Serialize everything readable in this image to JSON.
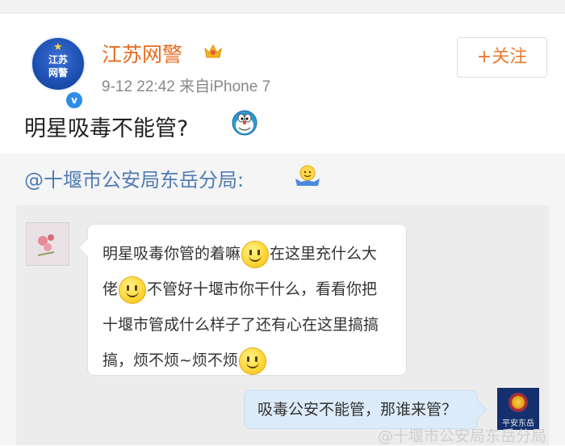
{
  "post": {
    "author": "江苏网警",
    "avatar_text_line1": "江苏",
    "avatar_text_line2": "网警",
    "meta": "9-12 22:42  来自iPhone 7",
    "follow_label": "+关注",
    "text": "明星吸毒不能管?",
    "emoji": "doraemon-icon"
  },
  "repost": {
    "author": "@十堰市公安局东岳分局:",
    "emoji": "shrug-icon",
    "chat": {
      "left_message_parts": [
        "明星吸毒你管的着嘛",
        "在这里充什么大佬",
        "不管好十堰市你干什么，看看你把十堰市管成什么样子了还有心在这里搞搞搞，烦不烦~烦不烦",
        ""
      ],
      "right_message": "吸毒公安不能管，那谁来管？",
      "right_avatar_text": "平安东岳"
    },
    "watermark": "@十堰市公安局东岳分局"
  },
  "colors": {
    "author_orange": "#e86a1f",
    "link_blue": "#4f7cb4",
    "follow_orange": "#ee7a30",
    "bubble_right": "#dcebfa"
  }
}
